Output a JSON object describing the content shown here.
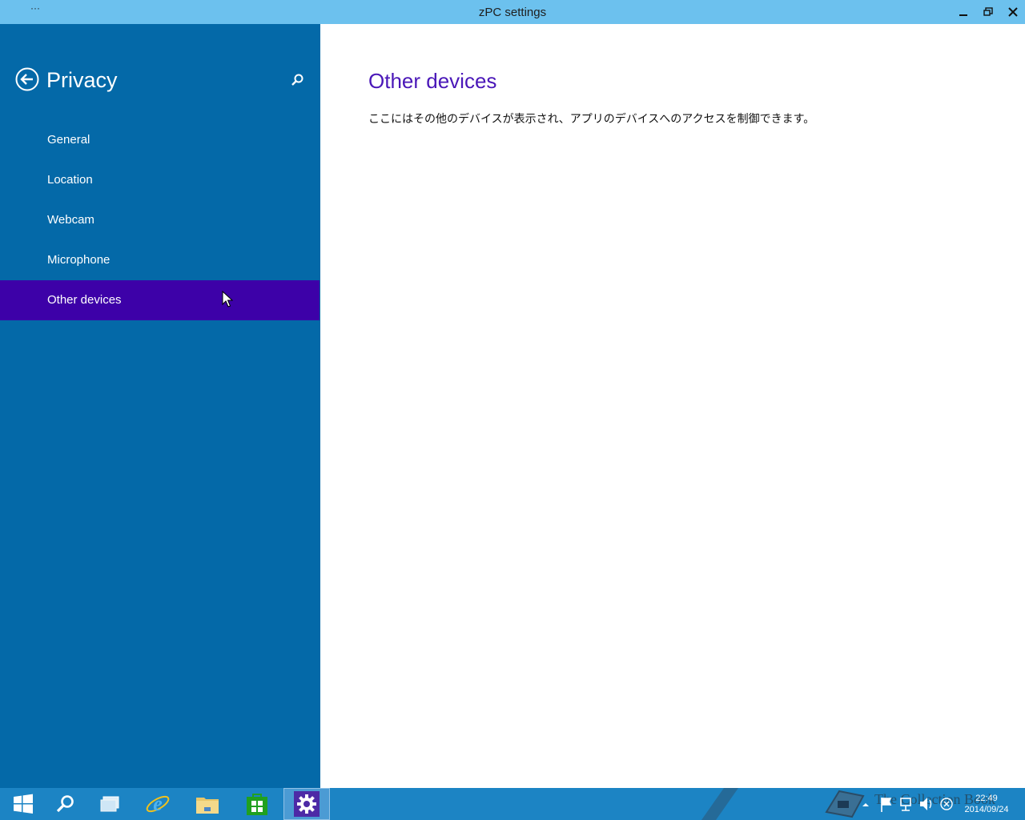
{
  "window": {
    "title": "zPC settings",
    "menu_glyph": "···"
  },
  "sidebar": {
    "heading": "Privacy",
    "items": [
      {
        "label": "General"
      },
      {
        "label": "Location"
      },
      {
        "label": "Webcam"
      },
      {
        "label": "Microphone"
      },
      {
        "label": "Other devices",
        "selected": true
      }
    ]
  },
  "main": {
    "title": "Other devices",
    "description": "ここにはその他のデバイスが表示され、アプリのデバイスへのアクセスを制御できます。"
  },
  "taskbar": {
    "apps": [
      "start-icon",
      "search-icon",
      "task-view-icon",
      "internet-explorer-icon",
      "file-explorer-icon",
      "store-icon",
      "settings-icon"
    ],
    "active_app": "settings-icon",
    "clock_time": "22:49",
    "clock_date": "2014/09/24",
    "watermark": "The Collection Book"
  },
  "colors": {
    "titlebar": "#6cc1ee",
    "sidebar": "#0469a8",
    "selected": "#3d01a8",
    "heading": "#4a17b8",
    "taskbar": "#1c84c4"
  }
}
